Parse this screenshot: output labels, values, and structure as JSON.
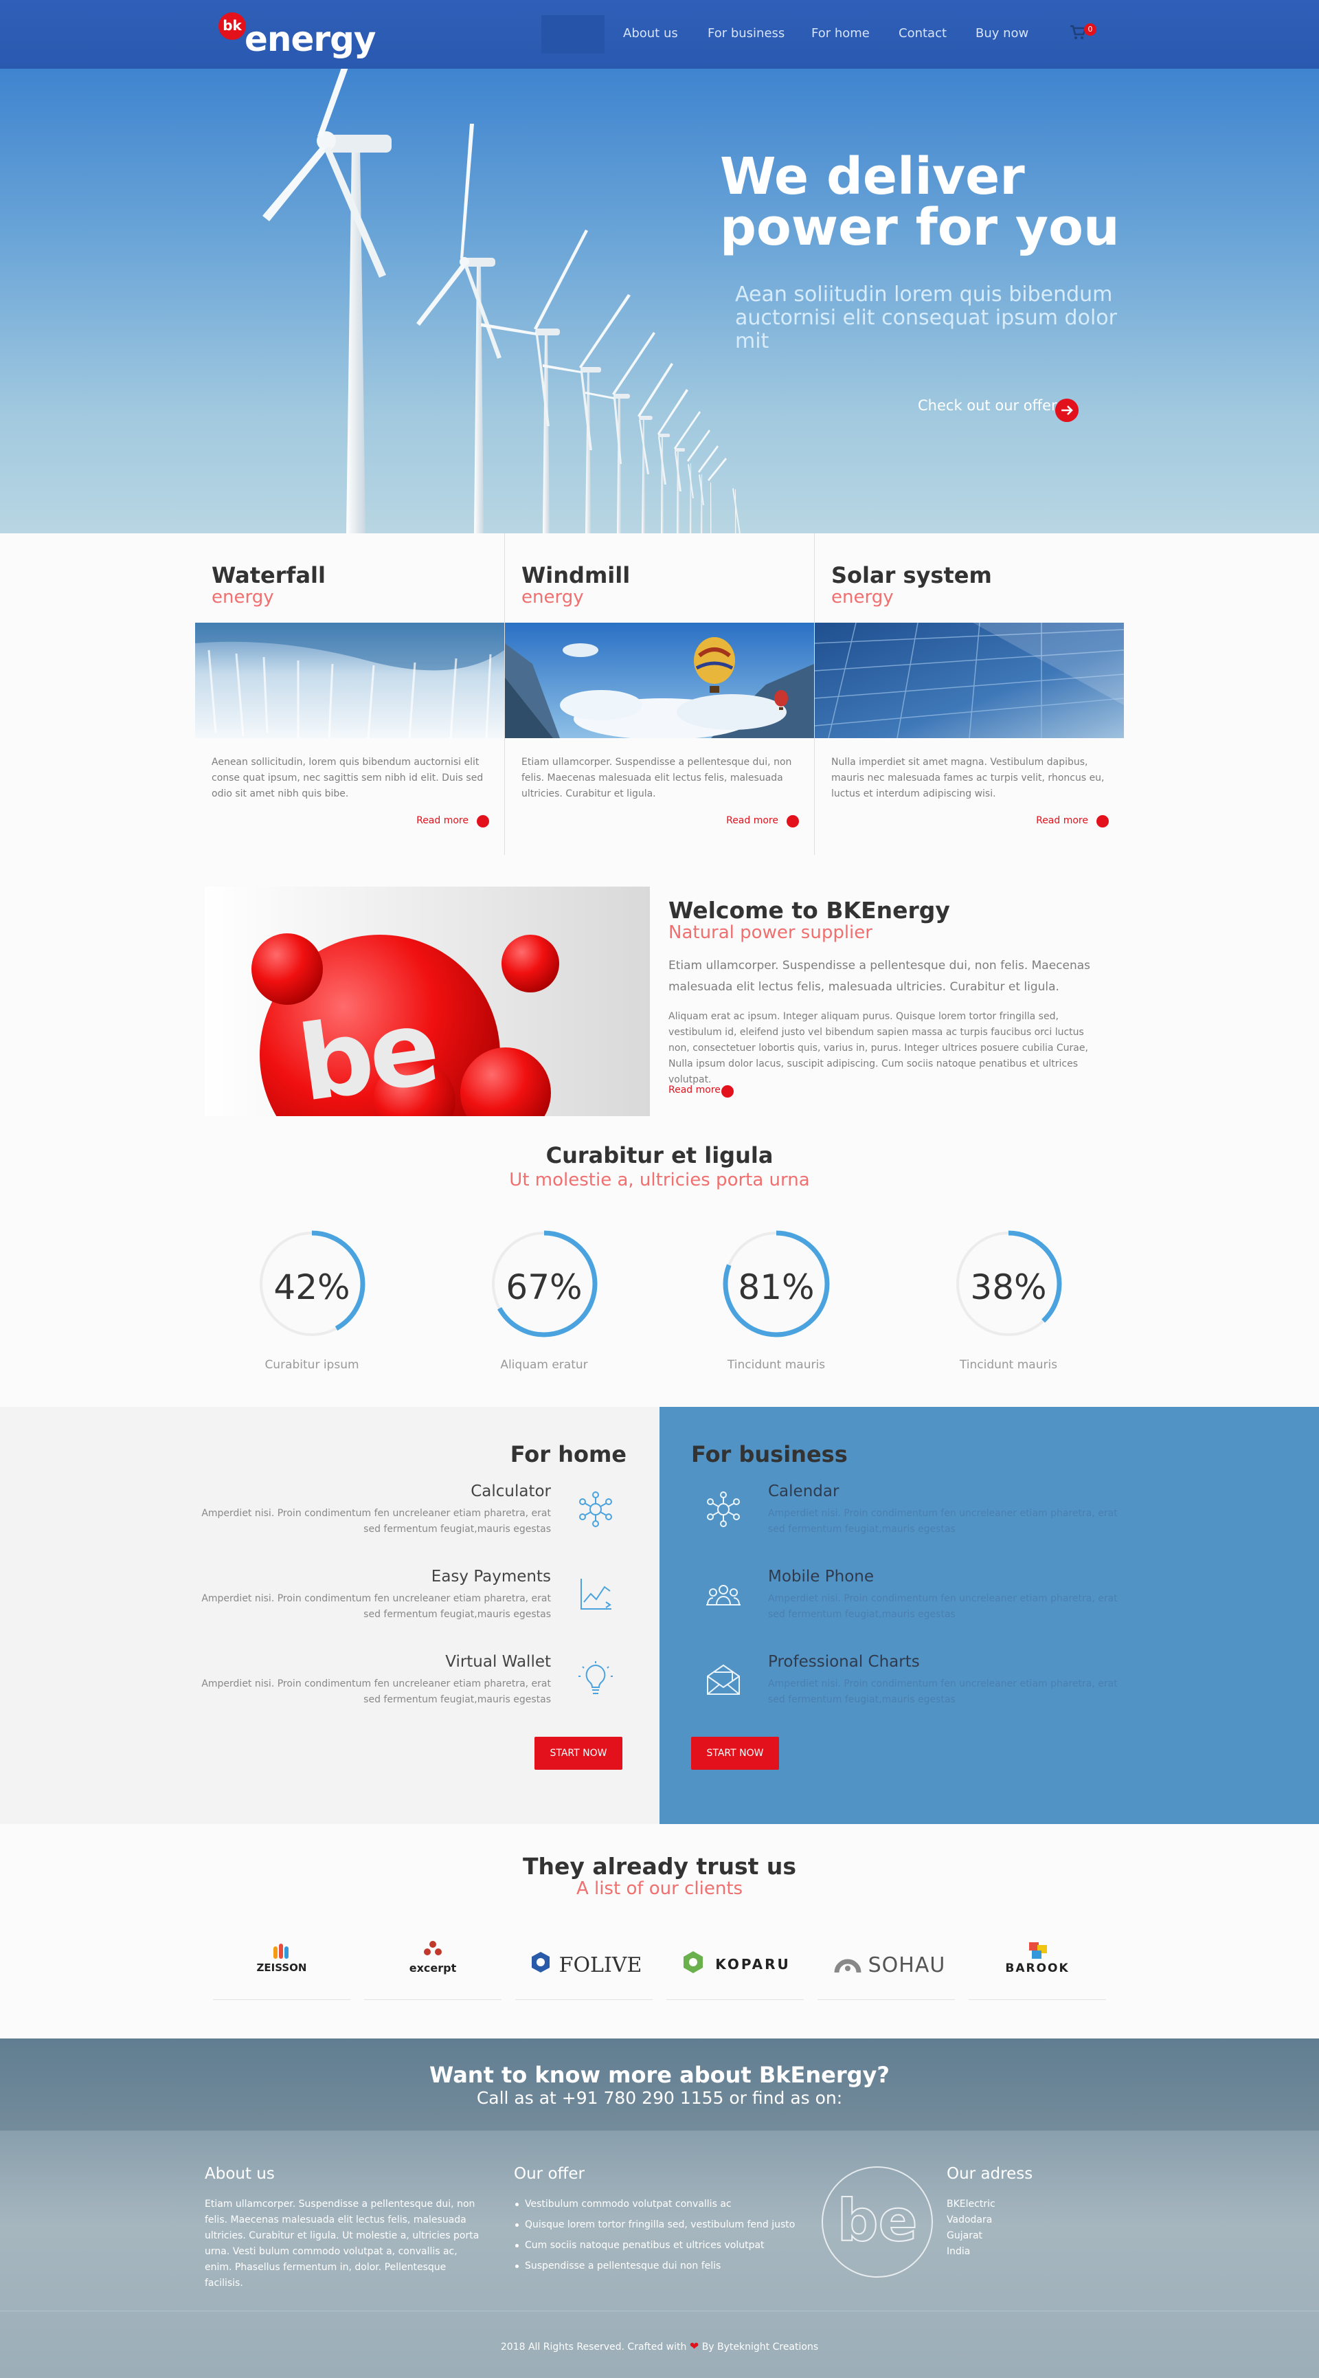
{
  "nav": {
    "logo_badge": "bk",
    "logo_text": "energy",
    "items": [
      "About us",
      "For business",
      "For home",
      "Contact",
      "Buy now"
    ],
    "cart_count": "0"
  },
  "hero": {
    "title_line1": "We deliver",
    "title_line2": "power for you",
    "subtitle": "Aean soliitudin lorem quis bibendum auctornisi elit consequat ipsum dolor mit",
    "cta": "Check out our offer"
  },
  "energy": [
    {
      "title": "Waterfall",
      "sub": "energy",
      "text": "Aenean sollicitudin, lorem quis bibendum auctornisi elit conse quat ipsum, nec sagittis sem nibh id elit. Duis sed odio sit amet nibh quis bibe.",
      "more": "Read more"
    },
    {
      "title": "Windmill",
      "sub": "energy",
      "text": "Etiam ullamcorper. Suspendisse a pellentesque dui, non felis. Maecenas malesuada elit lectus felis, malesuada ultricies. Curabitur et ligula.",
      "more": "Read more"
    },
    {
      "title": "Solar system",
      "sub": "energy",
      "text": "Nulla imperdiet sit amet magna. Vestibulum dapibus, mauris nec malesuada fames ac turpis velit, rhoncus eu, luctus et interdum adipiscing wisi.",
      "more": "Read more"
    }
  ],
  "welcome": {
    "logo_text": "be",
    "title": "Welcome to BKEnergy",
    "subtitle": "Natural power supplier",
    "p1": "Etiam ullamcorper. Suspendisse a pellentesque dui, non felis. Maecenas malesuada elit lectus felis, malesuada ultricies. Curabitur et ligula.",
    "p2": "Aliquam erat ac ipsum. Integer aliquam purus. Quisque lorem tortor fringilla sed, vestibulum id, eleifend justo vel bibendum sapien massa ac turpis faucibus orci luctus non, consectetuer lobortis quis, varius in, purus. Integer ultrices posuere cubilia Curae, Nulla ipsum dolor lacus, suscipit adipiscing. Cum sociis natoque penatibus et ultrices volutpat.",
    "more": "Read more"
  },
  "stats": {
    "title": "Curabitur et ligula",
    "subtitle": "Ut molestie a, ultricies porta urna",
    "items": [
      {
        "value": 42,
        "label_pct": "42%",
        "label": "Curabitur ipsum"
      },
      {
        "value": 67,
        "label_pct": "67%",
        "label": "Aliquam eratur"
      },
      {
        "value": 81,
        "label_pct": "81%",
        "label": "Tincidunt mauris"
      },
      {
        "value": 38,
        "label_pct": "38%",
        "label": "Tincidunt mauris"
      }
    ],
    "ring_color": "#4aa3de"
  },
  "home": {
    "title": "For home",
    "features": [
      {
        "title": "Calculator",
        "text": "Amperdiet nisi. Proin condimentum fen uncreleaner etiam pharetra, erat sed fermentum feugiat,mauris egestas",
        "icon": "network-icon"
      },
      {
        "title": "Easy Payments",
        "text": "Amperdiet nisi. Proin condimentum fen uncreleaner etiam pharetra, erat sed fermentum feugiat,mauris egestas",
        "icon": "chart-icon"
      },
      {
        "title": "Virtual Wallet",
        "text": "Amperdiet nisi. Proin condimentum fen uncreleaner etiam pharetra, erat sed fermentum feugiat,mauris egestas",
        "icon": "lightbulb-icon"
      }
    ],
    "button": "START NOW"
  },
  "business": {
    "title": "For business",
    "features": [
      {
        "title": "Calendar",
        "text": "Amperdiet nisi. Proin condimentum fen uncreleaner etiam pharetra, erat sed fermentum feugiat,mauris egestas",
        "icon": "network-icon"
      },
      {
        "title": "Mobile Phone",
        "text": "Amperdiet nisi. Proin condimentum fen uncreleaner etiam pharetra, erat sed fermentum feugiat,mauris egestas",
        "icon": "people-icon"
      },
      {
        "title": "Professional Charts",
        "text": "Amperdiet nisi. Proin condimentum fen uncreleaner etiam pharetra, erat sed fermentum feugiat,mauris egestas",
        "icon": "envelope-icon"
      }
    ],
    "button": "START NOW"
  },
  "clients": {
    "title": "They already trust us",
    "subtitle": "A list of our clients",
    "items": [
      "ZEISSON",
      "excerpt",
      "FOLIVE",
      "KOPARU",
      "SOHAU",
      "BAROOK"
    ]
  },
  "footer": {
    "headline": "Want to know more about BkEnergy?",
    "call": "Call as at +91 780 290 1155 or find as on:",
    "about_title": "About us",
    "about_text": "Etiam ullamcorper. Suspendisse a pellentesque dui, non felis. Maecenas malesuada elit lectus felis, malesuada ultricies. Curabitur et ligula. Ut molestie a, ultricies porta urna. Vesti bulum commodo volutpat a, convallis ac, enim. Phasellus fermentum in, dolor. Pellentesque facilisis.",
    "offer_title": "Our offer",
    "offer_items": [
      "Vestibulum commodo volutpat convallis ac",
      "Quisque lorem tortor fringilla sed, vestibulum fend justo",
      "Cum sociis natoque penatibus et ultrices volutpat",
      "Suspendisse a pellentesque dui non felis"
    ],
    "logo_text": "be",
    "address_title": "Our adress",
    "address_lines": [
      "BKElectric",
      "Vadodara",
      "Gujarat",
      "India"
    ],
    "copyright_pre": "2018 All Rights Reserved. Crafted with",
    "copyright_post": "By Byteknight Creations"
  },
  "colors": {
    "accent": "#e3111b",
    "brand_blue": "#2f5fb8",
    "pink": "#f06f6f",
    "business_bg": "#5293c6"
  }
}
